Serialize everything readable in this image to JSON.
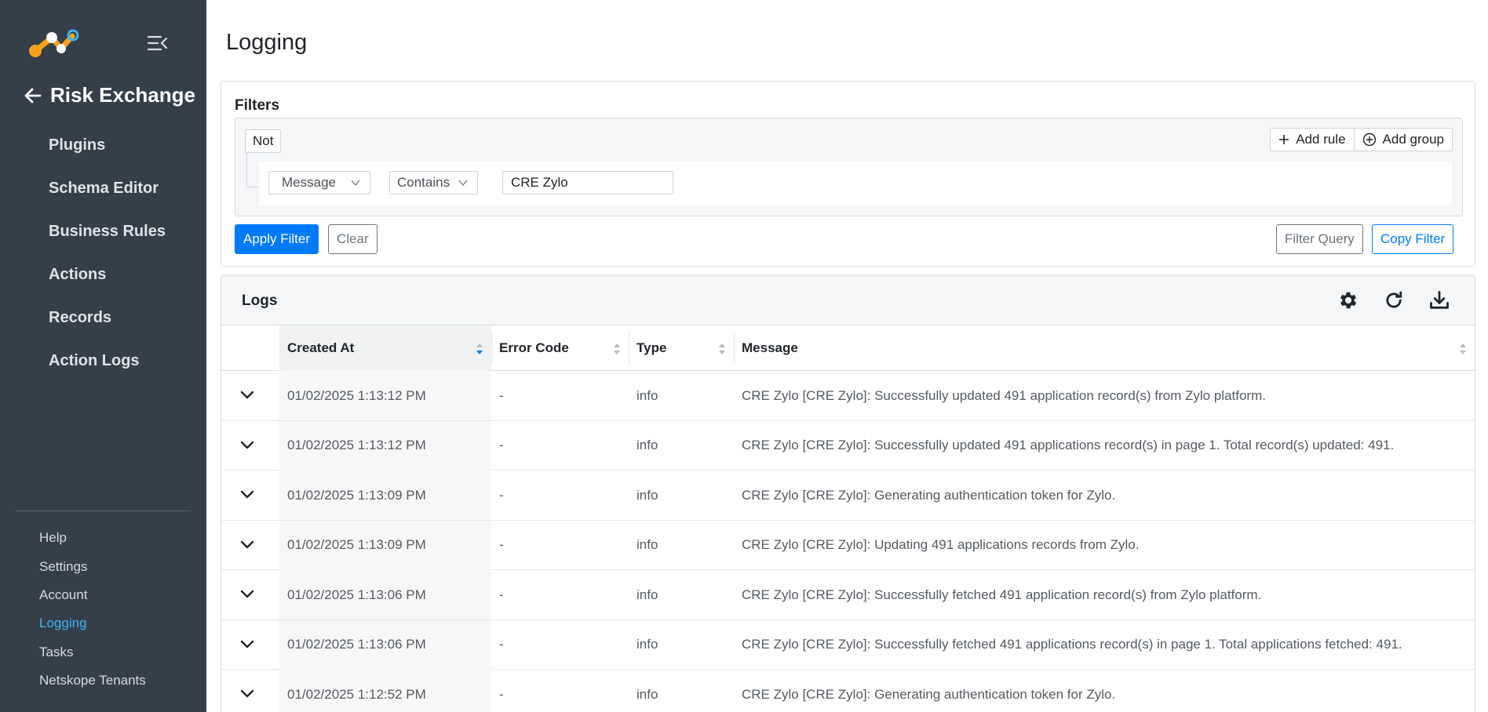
{
  "sidebar": {
    "back_title": "Risk Exchange",
    "main_items": [
      {
        "label": "Plugins"
      },
      {
        "label": "Schema Editor"
      },
      {
        "label": "Business Rules"
      },
      {
        "label": "Actions"
      },
      {
        "label": "Records"
      },
      {
        "label": "Action Logs"
      }
    ],
    "bottom_items": [
      {
        "label": "Help",
        "active": false
      },
      {
        "label": "Settings",
        "active": false
      },
      {
        "label": "Account",
        "active": false
      },
      {
        "label": "Logging",
        "active": true
      },
      {
        "label": "Tasks",
        "active": false
      },
      {
        "label": "Netskope Tenants",
        "active": false
      }
    ],
    "colors": {
      "background": "#343f4a",
      "active": "#3cb4f0"
    }
  },
  "page": {
    "title": "Logging"
  },
  "filters": {
    "title": "Filters",
    "not_label": "Not",
    "add_rule_label": "Add rule",
    "add_group_label": "Add group",
    "rule": {
      "field": "Message",
      "operator": "Contains",
      "value": "CRE Zylo"
    },
    "apply_label": "Apply Filter",
    "clear_label": "Clear",
    "filter_query_label": "Filter Query",
    "copy_filter_label": "Copy Filter"
  },
  "logs": {
    "title": "Logs",
    "toolbar_icons": [
      "gear-icon",
      "refresh-icon",
      "download-icon"
    ],
    "columns": {
      "created_at": "Created At",
      "error_code": "Error Code",
      "type": "Type",
      "message": "Message"
    },
    "sorted_column": "created_at",
    "rows": [
      {
        "created_at": "01/02/2025 1:13:12 PM",
        "error_code": "-",
        "type": "info",
        "message": "CRE Zylo [CRE Zylo]: Successfully updated 491 application record(s) from Zylo platform."
      },
      {
        "created_at": "01/02/2025 1:13:12 PM",
        "error_code": "-",
        "type": "info",
        "message": "CRE Zylo [CRE Zylo]: Successfully updated 491 applications record(s) in page 1. Total record(s) updated: 491."
      },
      {
        "created_at": "01/02/2025 1:13:09 PM",
        "error_code": "-",
        "type": "info",
        "message": "CRE Zylo [CRE Zylo]: Generating authentication token for Zylo."
      },
      {
        "created_at": "01/02/2025 1:13:09 PM",
        "error_code": "-",
        "type": "info",
        "message": "CRE Zylo [CRE Zylo]: Updating 491 applications records from Zylo."
      },
      {
        "created_at": "01/02/2025 1:13:06 PM",
        "error_code": "-",
        "type": "info",
        "message": "CRE Zylo [CRE Zylo]: Successfully fetched 491 application record(s) from Zylo platform."
      },
      {
        "created_at": "01/02/2025 1:13:06 PM",
        "error_code": "-",
        "type": "info",
        "message": "CRE Zylo [CRE Zylo]: Successfully fetched 491 applications record(s) in page 1. Total applications fetched: 491."
      },
      {
        "created_at": "01/02/2025 1:12:52 PM",
        "error_code": "-",
        "type": "info",
        "message": "CRE Zylo [CRE Zylo]: Generating authentication token for Zylo."
      }
    ]
  }
}
